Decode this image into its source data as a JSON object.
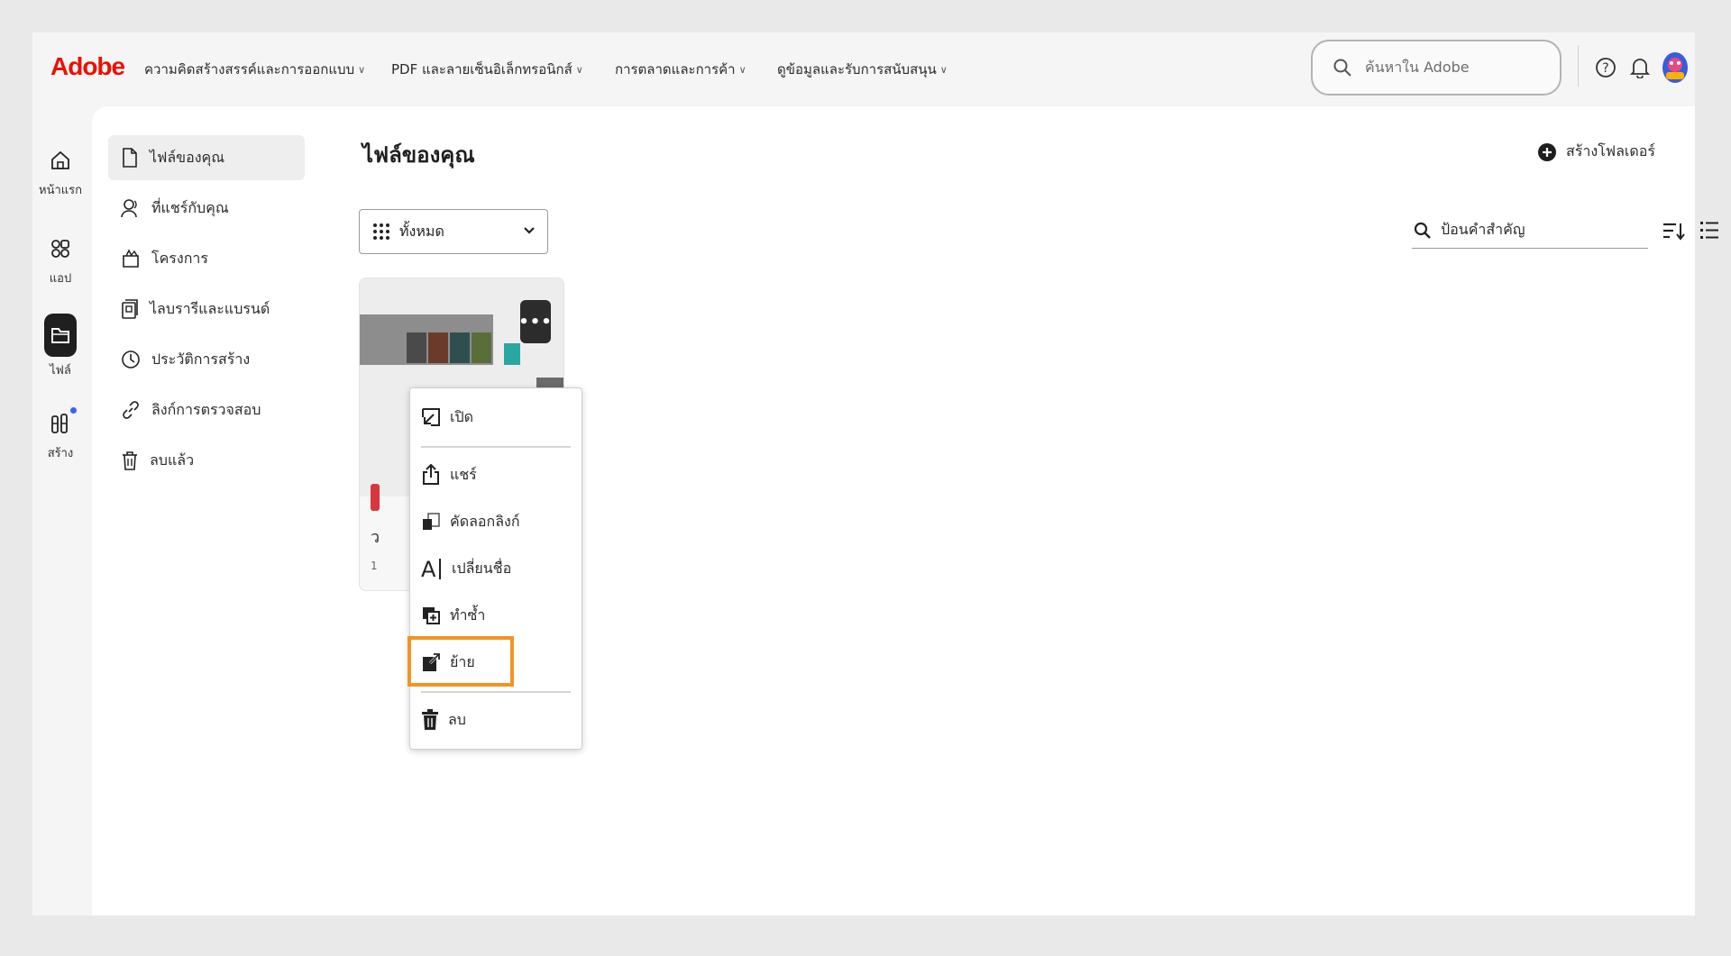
{
  "brand": {
    "logo": "Adobe",
    "color": "#eb1000"
  },
  "nav": [
    {
      "label": "ความคิดสร้างสรรค์และการออกแบบ"
    },
    {
      "label": "PDF และลายเซ็นอิเล็กทรอนิกส์"
    },
    {
      "label": "การตลาดและการค้า"
    },
    {
      "label": "ดูข้อมูลและรับการสนับสนุน"
    }
  ],
  "search": {
    "placeholder": "ค้นหาใน Adobe"
  },
  "rail": [
    {
      "label": "หน้าแรก",
      "icon": "home-icon"
    },
    {
      "label": "แอป",
      "icon": "apps-icon"
    },
    {
      "label": "ไฟล์",
      "icon": "folder-icon",
      "active": true
    },
    {
      "label": "สร้าง",
      "icon": "create-icon"
    }
  ],
  "sidebar": [
    {
      "label": "ไฟล์ของคุณ",
      "icon": "file-icon",
      "active": true
    },
    {
      "label": "ที่แชร์กับคุณ",
      "icon": "shared-user-icon"
    },
    {
      "label": "โครงการ",
      "icon": "projects-icon"
    },
    {
      "label": "ไลบรารีและแบรนด์",
      "icon": "library-icon"
    },
    {
      "label": "ประวัติการสร้าง",
      "icon": "history-icon"
    },
    {
      "label": "ลิงก์การตรวจสอบ",
      "icon": "link-icon"
    },
    {
      "label": "ลบแล้ว",
      "icon": "trash-icon"
    }
  ],
  "main": {
    "title": "ไฟล์ของคุณ",
    "new_folder": "สร้างโฟลเดอร์",
    "filter": "ทั้งหมด",
    "keyword_placeholder": "ป้อนคำสำคัญ"
  },
  "card": {
    "more": "•••",
    "name_initial": "ว",
    "meta_initial": "1"
  },
  "menu": {
    "items": [
      {
        "label": "เปิด",
        "icon": "open-icon"
      },
      {
        "label": "แชร์",
        "icon": "share-icon"
      },
      {
        "label": "คัดลอกลิงก์",
        "icon": "copy-link-icon"
      },
      {
        "label": "เปลี่ยนชื่อ",
        "icon": "rename-icon"
      },
      {
        "label": "ทำซ้ำ",
        "icon": "duplicate-icon"
      },
      {
        "label": "ย้าย",
        "icon": "move-icon",
        "highlighted": true
      },
      {
        "label": "ลบ",
        "icon": "delete-icon"
      }
    ],
    "highlight_color": "#f29423"
  }
}
